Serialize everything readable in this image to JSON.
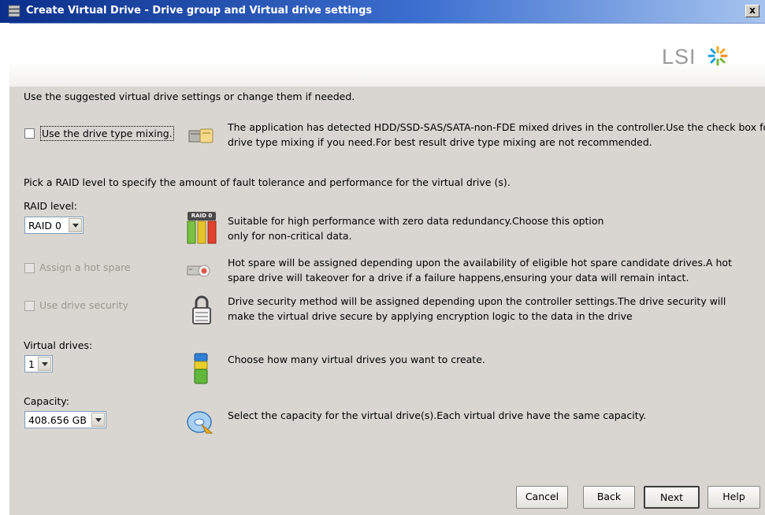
{
  "window": {
    "title": "Create Virtual Drive - Drive group and Virtual drive settings",
    "close_label": "x"
  },
  "header": {
    "logo_text": "LSI"
  },
  "intro_text": "Use the suggested virtual drive settings or change them if needed.",
  "drive_type_mixing": {
    "label": "Use the drive type mixing.",
    "checked": false,
    "description_line1": "The application has detected HDD/SSD-SAS/SATA-non-FDE mixed drives in the controller.Use the check box for",
    "description_line2": "drive type mixing if you need.For best result drive type mixing are not recommended."
  },
  "raid_intro": "Pick a RAID level to specify the amount of fault tolerance and performance for the virtual drive (s).",
  "raid_level": {
    "label": "RAID level:",
    "value": "RAID 0",
    "icon_badge": "RAID 0",
    "description_line1": "Suitable for high performance with zero data redundancy.Choose this option",
    "description_line2": "only for non-critical data."
  },
  "hot_spare": {
    "label": "Assign a hot spare",
    "checked": false,
    "enabled": false,
    "description_line1": "Hot spare will be assigned depending upon the availability of eligible hot spare candidate drives.A hot",
    "description_line2": "spare drive will takeover for a drive if a failure happens,ensuring your data will remain intact."
  },
  "drive_security": {
    "label": "Use drive security",
    "checked": false,
    "enabled": false,
    "description_line1": "Drive security method will be assigned depending upon the controller settings.The drive security will",
    "description_line2": "make the virtual drive secure by applying encryption logic to the data in the drive"
  },
  "virtual_drives": {
    "label": "Virtual drives:",
    "value": "1",
    "description": "Choose how many virtual drives you want to create."
  },
  "capacity": {
    "label": "Capacity:",
    "value": "408.656 GB",
    "description": "Select the capacity for the virtual drive(s).Each virtual drive have the same capacity."
  },
  "buttons": {
    "cancel": "Cancel",
    "back": "Back",
    "next": "Next",
    "help": "Help"
  },
  "colors": {
    "titlebar": "#0a2f8a",
    "panel_bg": "#d9d6d1",
    "logo_text": "#9a9a9a"
  }
}
